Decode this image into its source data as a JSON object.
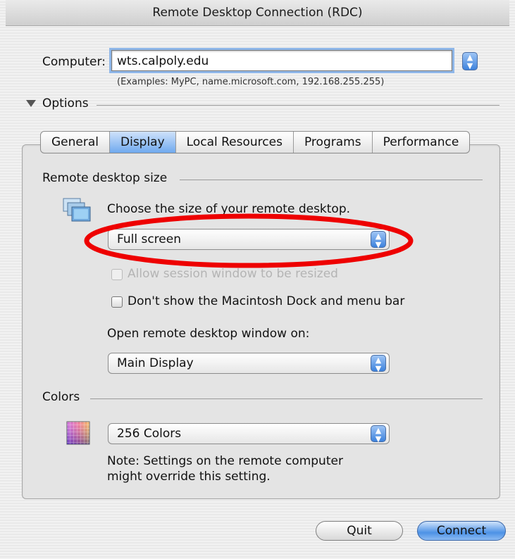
{
  "window": {
    "title": "Remote Desktop Connection (RDC)"
  },
  "computer": {
    "label": "Computer:",
    "value": "wts.calpoly.edu",
    "examples": "(Examples: MyPC, name.microsoft.com, 192.168.255.255)"
  },
  "options": {
    "label": "Options"
  },
  "tabs": [
    {
      "label": "General"
    },
    {
      "label": "Display",
      "active": true
    },
    {
      "label": "Local Resources"
    },
    {
      "label": "Programs"
    },
    {
      "label": "Performance"
    }
  ],
  "display": {
    "remote_size_heading": "Remote desktop size",
    "choose_size_text": "Choose the size of your remote desktop.",
    "size_popup_value": "Full screen",
    "allow_resize_label": "Allow session window to be resized",
    "hide_dock_label": "Don't show the Macintosh Dock and menu bar",
    "open_on_label": "Open remote desktop window on:",
    "display_popup_value": "Main Display",
    "colors_heading": "Colors",
    "colors_popup_value": "256 Colors",
    "note_line1": "Note: Settings on the remote computer",
    "note_line2": "might override this setting."
  },
  "buttons": {
    "quit": "Quit",
    "connect": "Connect"
  },
  "colors": {
    "annotation_oval": "#ee0000",
    "accent_blue": "#4d92e6"
  },
  "icons": {
    "options_disclosure": "disclosure-triangle-down",
    "stepper": "up-down-arrows",
    "monitors": "monitors-icon",
    "palette": "color-palette-icon"
  }
}
